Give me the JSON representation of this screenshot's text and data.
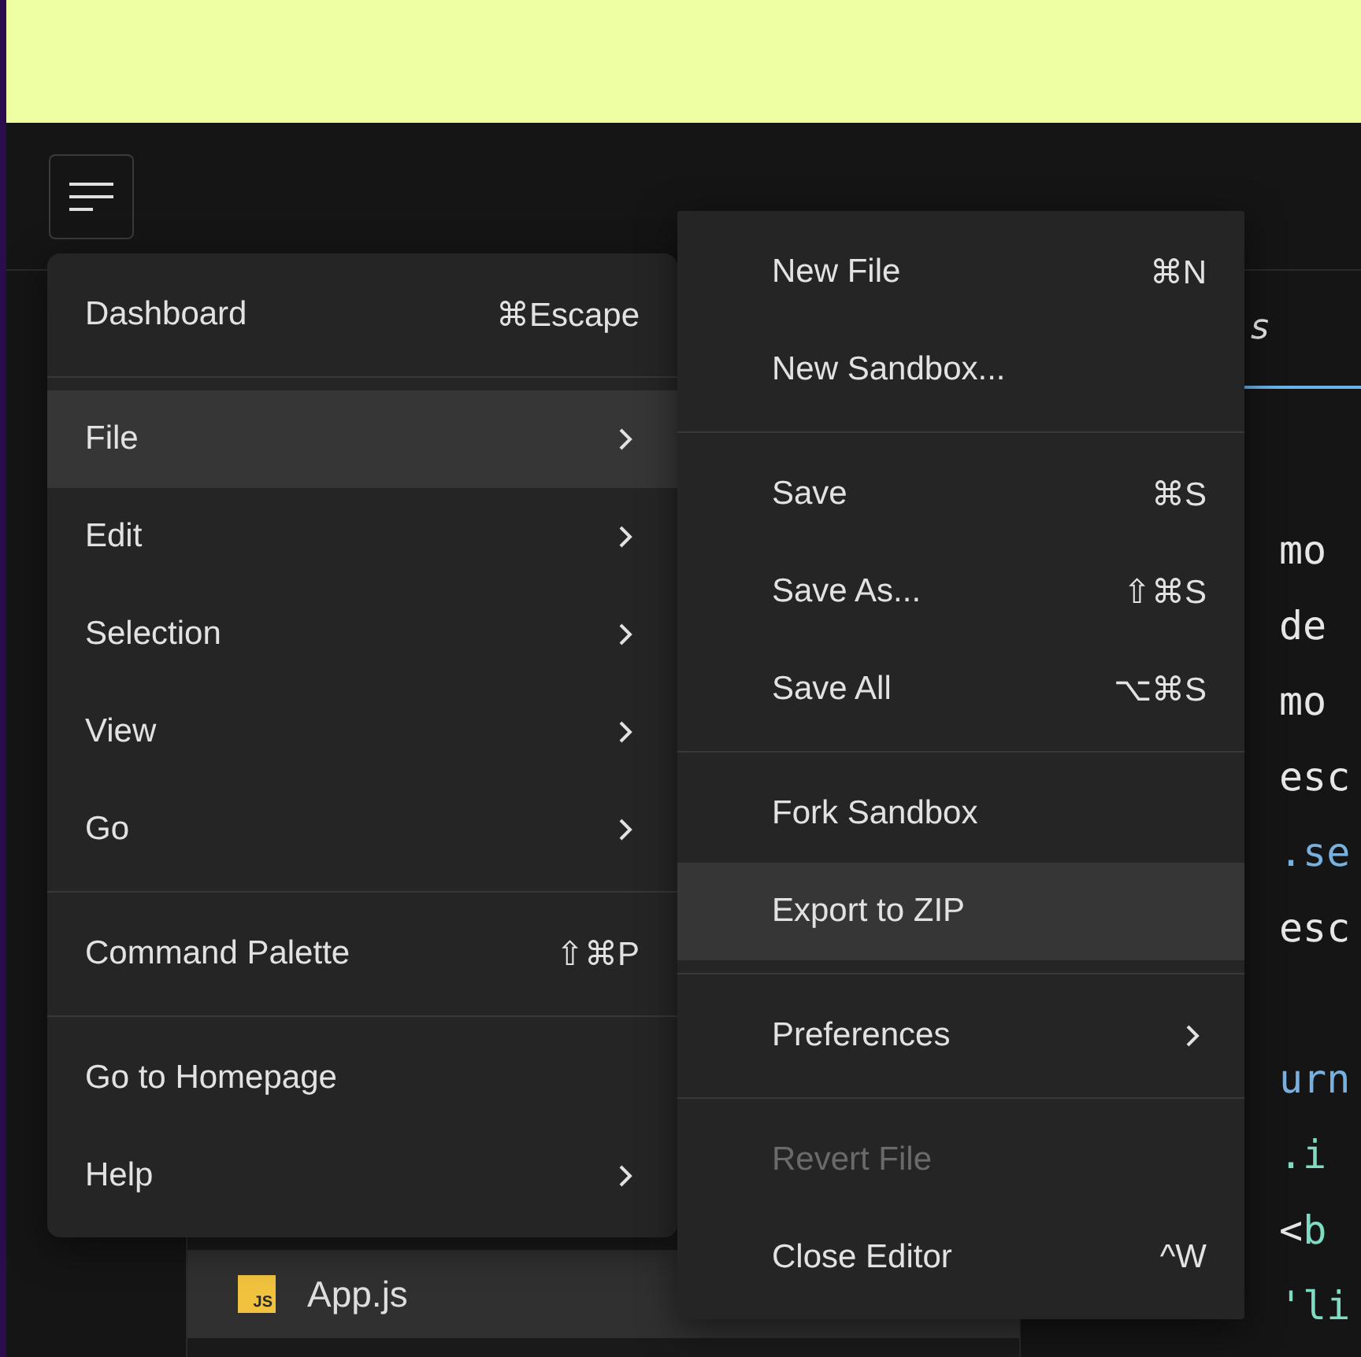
{
  "main_menu": {
    "groups": [
      [
        {
          "label": "Dashboard",
          "shortcut": "⌘Escape",
          "has_submenu": false,
          "selected": false
        }
      ],
      [
        {
          "label": "File",
          "has_submenu": true,
          "selected": true
        },
        {
          "label": "Edit",
          "has_submenu": true,
          "selected": false
        },
        {
          "label": "Selection",
          "has_submenu": true,
          "selected": false
        },
        {
          "label": "View",
          "has_submenu": true,
          "selected": false
        },
        {
          "label": "Go",
          "has_submenu": true,
          "selected": false
        }
      ],
      [
        {
          "label": "Command Palette",
          "shortcut": "⇧⌘P",
          "has_submenu": false,
          "selected": false
        }
      ],
      [
        {
          "label": "Go to Homepage",
          "has_submenu": false,
          "selected": false
        },
        {
          "label": "Help",
          "has_submenu": true,
          "selected": false
        }
      ]
    ]
  },
  "file_submenu": {
    "groups": [
      [
        {
          "label": "New File",
          "shortcut": "⌘N",
          "has_submenu": false,
          "selected": false,
          "disabled": false
        },
        {
          "label": "New Sandbox...",
          "has_submenu": false,
          "selected": false,
          "disabled": false
        }
      ],
      [
        {
          "label": "Save",
          "shortcut": "⌘S",
          "has_submenu": false,
          "selected": false,
          "disabled": false
        },
        {
          "label": "Save As...",
          "shortcut": "⇧⌘S",
          "has_submenu": false,
          "selected": false,
          "disabled": false
        },
        {
          "label": "Save All",
          "shortcut": "⌥⌘S",
          "has_submenu": false,
          "selected": false,
          "disabled": false
        }
      ],
      [
        {
          "label": "Fork Sandbox",
          "has_submenu": false,
          "selected": false,
          "disabled": false
        },
        {
          "label": "Export to ZIP",
          "has_submenu": false,
          "selected": true,
          "disabled": false
        }
      ],
      [
        {
          "label": "Preferences",
          "has_submenu": true,
          "selected": false,
          "disabled": false
        }
      ],
      [
        {
          "label": "Revert File",
          "has_submenu": false,
          "selected": false,
          "disabled": true
        },
        {
          "label": "Close Editor",
          "shortcut": "^W",
          "has_submenu": false,
          "selected": false,
          "disabled": false
        }
      ]
    ]
  },
  "explorer": {
    "files": [
      {
        "name": "App.js",
        "icon_label": "JS",
        "selected": true
      }
    ]
  },
  "editor": {
    "tabs": [
      {
        "label": "s",
        "selected": true
      }
    ],
    "lines": [
      {
        "kind": "code",
        "tokens": [
          {
            "text": "mo",
            "kind": "plain"
          }
        ]
      },
      {
        "kind": "code",
        "tokens": [
          {
            "text": "de",
            "kind": "plain"
          }
        ]
      },
      {
        "kind": "code",
        "tokens": [
          {
            "text": "mo",
            "kind": "plain"
          }
        ]
      },
      {
        "kind": "code",
        "tokens": [
          {
            "text": "esc",
            "kind": "plain"
          }
        ]
      },
      {
        "kind": "code",
        "tokens": [
          {
            "text": ".se",
            "kind": "keyword"
          }
        ]
      },
      {
        "kind": "code",
        "tokens": [
          {
            "text": "esc",
            "kind": "plain"
          }
        ]
      },
      {
        "kind": "blank"
      },
      {
        "kind": "code",
        "tokens": [
          {
            "text": "urn",
            "kind": "keyword"
          }
        ]
      },
      {
        "kind": "code",
        "tokens": [
          {
            "text": ".i",
            "kind": "tag"
          }
        ]
      },
      {
        "kind": "code",
        "tokens": [
          {
            "text": "<",
            "kind": "plain"
          },
          {
            "text": "b",
            "kind": "tag"
          }
        ]
      },
      {
        "kind": "code",
        "tokens": [
          {
            "text": "'li",
            "kind": "tag"
          }
        ]
      }
    ]
  }
}
